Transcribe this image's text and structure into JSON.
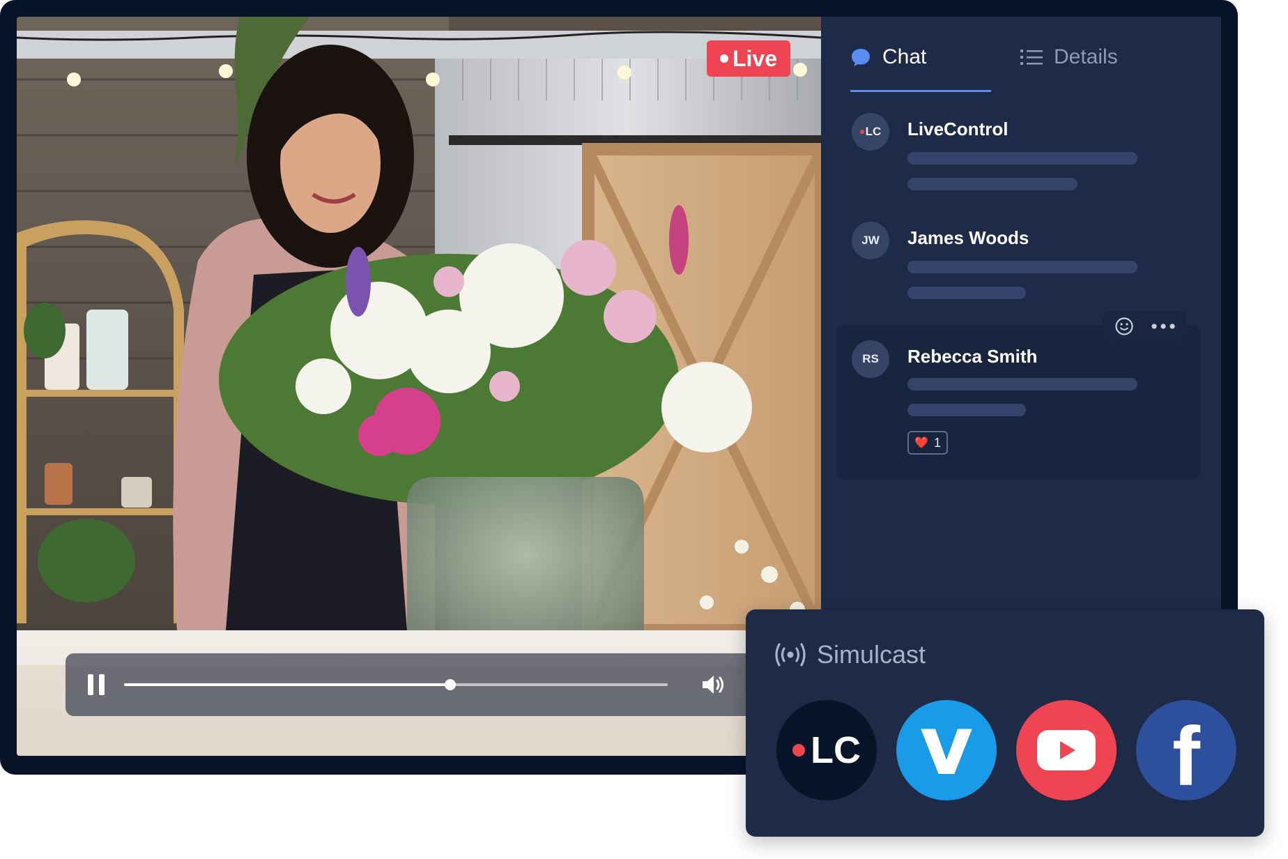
{
  "video": {
    "live_label": "Live",
    "progress": 0.6
  },
  "chat": {
    "tabs": [
      {
        "label": "Chat",
        "icon": "chat-bubble-icon",
        "active": true
      },
      {
        "label": "Details",
        "icon": "list-icon",
        "active": false
      }
    ],
    "messages": [
      {
        "initials": "LC",
        "name": "LiveControl"
      },
      {
        "initials": "JW",
        "name": "James Woods"
      },
      {
        "initials": "RS",
        "name": "Rebecca Smith",
        "reaction": {
          "emoji": "❤️",
          "count": "1"
        }
      }
    ]
  },
  "simulcast": {
    "title": "Simulcast",
    "platforms": [
      {
        "name": "LiveControl",
        "label": "LC",
        "color": "#0a1428"
      },
      {
        "name": "Vimeo",
        "label": "v",
        "color": "#1a9be8"
      },
      {
        "name": "YouTube",
        "color": "#ef4553"
      },
      {
        "name": "Facebook",
        "label": "f",
        "color": "#2d4f9c"
      }
    ]
  },
  "colors": {
    "accent": "#ee4553",
    "panel": "#1e2b48",
    "frame": "#0a1428",
    "tab_underline": "#5b8cf0"
  }
}
